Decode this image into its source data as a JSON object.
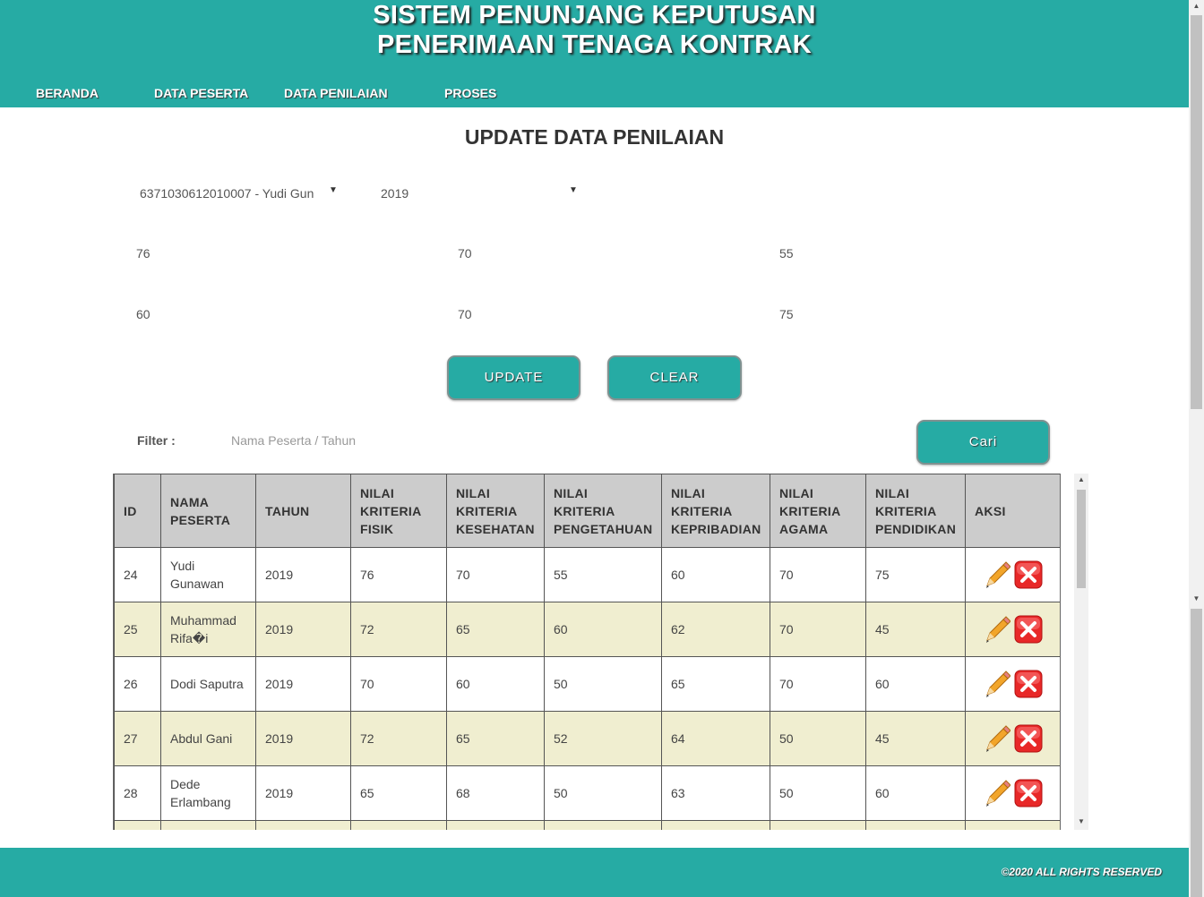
{
  "header": {
    "title_line1": "SISTEM PENUNJANG KEPUTUSAN",
    "title_line2": "PENERIMAAN TENAGA KONTRAK",
    "nav": [
      "BERANDA",
      "DATA PESERTA",
      "DATA PENILAIAN",
      "PROSES"
    ]
  },
  "form": {
    "page_title": "UPDATE DATA PENILAIAN",
    "peserta_select": "6371030612010007 - Yudi Gunawan",
    "tahun_select": "2019",
    "fields": [
      "76",
      "70",
      "55",
      "60",
      "70",
      "75"
    ],
    "update_label": "UPDATE",
    "clear_label": "CLEAR"
  },
  "filter": {
    "label": "Filter :",
    "placeholder": "Nama Peserta / Tahun",
    "search_label": "Cari"
  },
  "table": {
    "columns": [
      "ID",
      "NAMA PESERTA",
      "TAHUN",
      "NILAI KRITERIA FISIK",
      "NILAI KRITERIA KESEHATAN",
      "NILAI KRITERIA PENGETAHUAN",
      "NILAI KRITERIA KEPRIBADIAN",
      "NILAI KRITERIA AGAMA",
      "NILAI KRITERIA PENDIDIKAN",
      "AKSI"
    ],
    "rows": [
      [
        "24",
        "Yudi Gunawan",
        "2019",
        "76",
        "70",
        "55",
        "60",
        "70",
        "75"
      ],
      [
        "25",
        "Muhammad Rifa�i",
        "2019",
        "72",
        "65",
        "60",
        "62",
        "70",
        "45"
      ],
      [
        "26",
        "Dodi Saputra",
        "2019",
        "70",
        "60",
        "50",
        "65",
        "70",
        "60"
      ],
      [
        "27",
        "Abdul Gani",
        "2019",
        "72",
        "65",
        "52",
        "64",
        "50",
        "45"
      ],
      [
        "28",
        "Dede Erlambang",
        "2019",
        "65",
        "68",
        "50",
        "63",
        "50",
        "60"
      ]
    ],
    "edit_icon": "pencil-icon",
    "delete_icon": "delete-icon"
  },
  "footer": {
    "text": "©2020 ALL RIGHTS RESERVED"
  },
  "colors": {
    "primary": "#26aba4",
    "row_alt": "#f0eed0",
    "header_bg": "#cccccc",
    "delete_red": "#e02020",
    "pencil_orange": "#f0a020"
  }
}
